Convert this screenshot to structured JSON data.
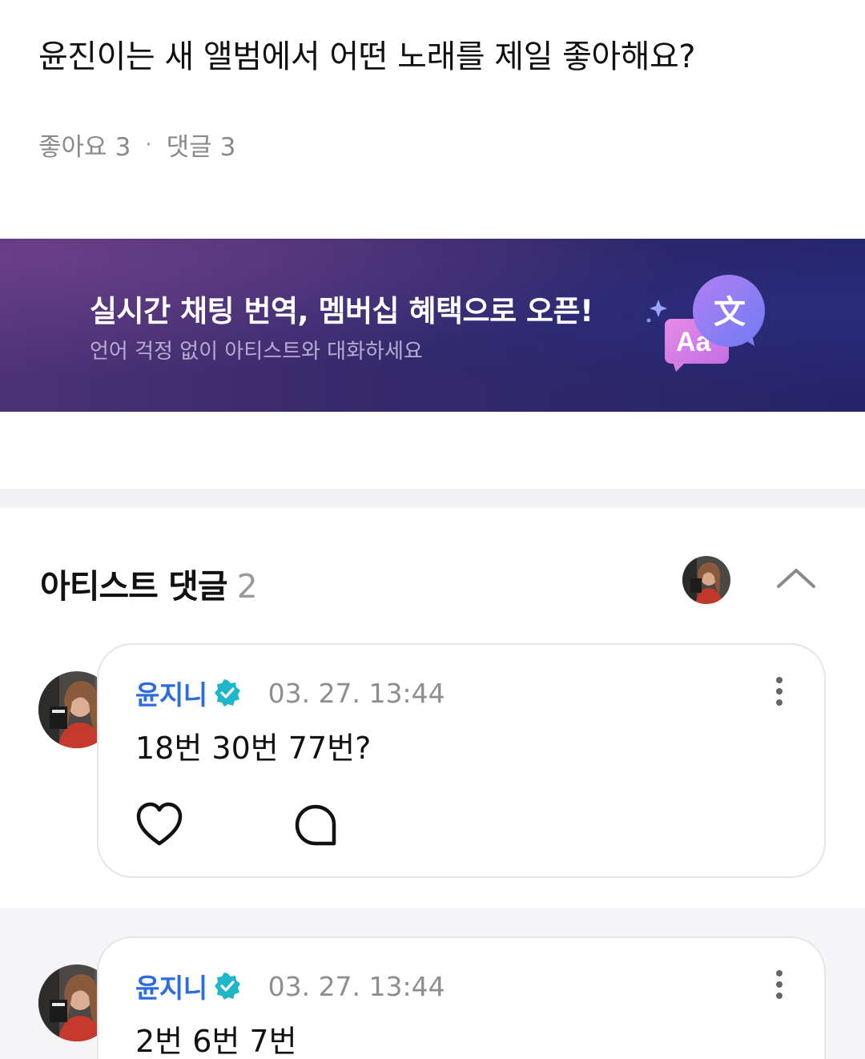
{
  "post": {
    "title": "윤진이는 새 앨범에서 어떤 노래를 제일 좋아해요?",
    "likes_label": "좋아요",
    "likes_count": "3",
    "separator": "·",
    "comments_label": "댓글",
    "comments_count": "3"
  },
  "banner": {
    "title": "실시간 채팅 번역, 멤버십 혜택으로 오픈!",
    "subtitle": "언어 걱정 없이 아티스트와 대화하세요",
    "badge_glyph": "文",
    "badge_latin": "Aa"
  },
  "artist_comments": {
    "title": "아티스트 댓글",
    "count": "2"
  },
  "comments": [
    {
      "author": "윤지니",
      "time": "03. 27. 13:44",
      "text": "18번 30번 77번?"
    },
    {
      "author": "윤지니",
      "time": "03. 27. 13:44",
      "text": "2번 6번 7번"
    }
  ],
  "icons": {
    "verified": "verified-badge-icon",
    "more": "more-vertical-icon",
    "like": "heart-icon",
    "reply": "speech-bubble-icon",
    "collapse": "chevron-up-icon"
  },
  "colors": {
    "author": "#2d6be0",
    "verified": "#1fb6c9",
    "banner_start": "#4c3275",
    "banner_end": "#24246a"
  }
}
